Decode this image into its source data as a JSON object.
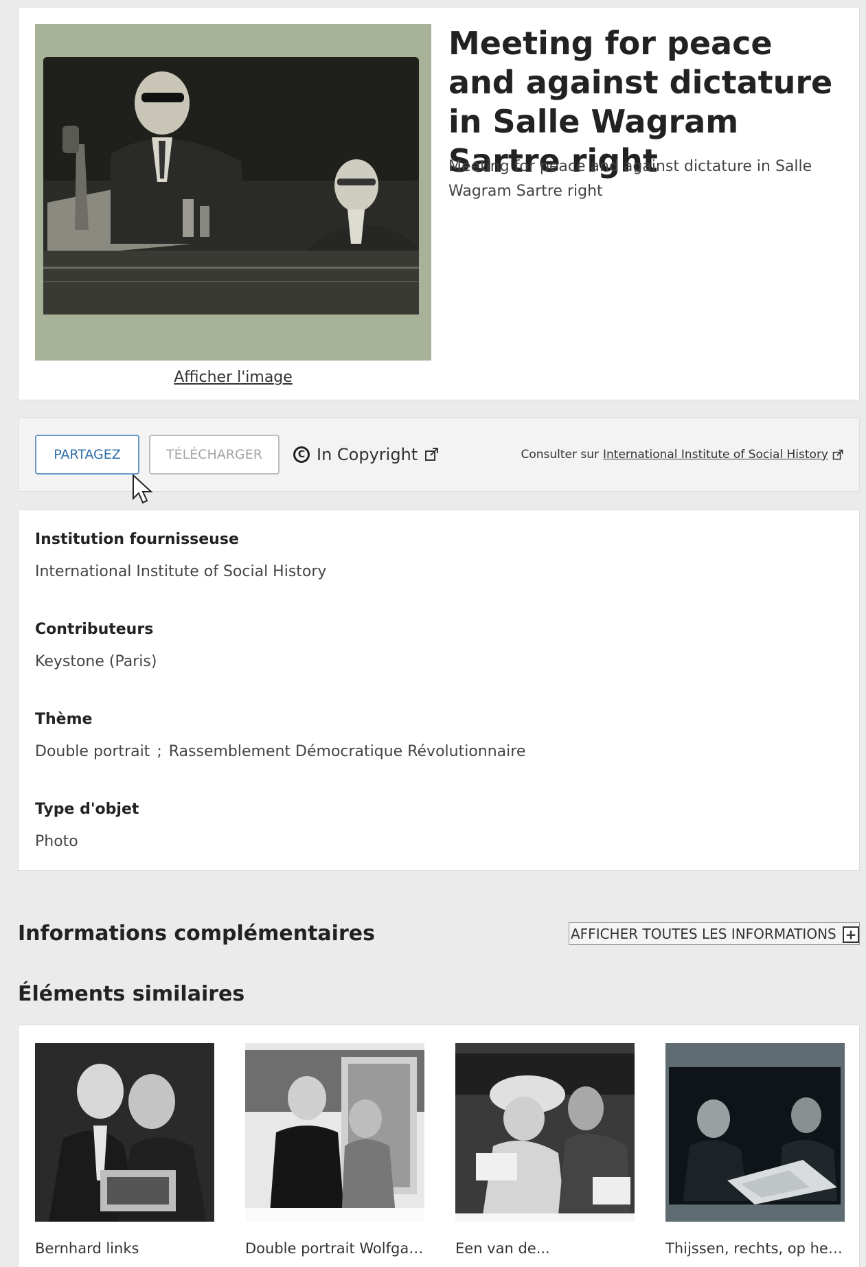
{
  "record": {
    "title": "Meeting for peace and against dictature in Salle Wagram Sartre right",
    "description": "Meeting for peace and against dictature in Salle Wagram Sartre right",
    "view_image_label": "Afficher l'image"
  },
  "actions": {
    "share_label": "PARTAGEZ",
    "download_label": "TÉLÉCHARGER",
    "rights_label": "In Copyright",
    "rights_icon": "copyright-icon",
    "consult_prefix": "Consulter sur",
    "provider_link": "International Institute of Social History"
  },
  "metadata": [
    {
      "label": "Institution fournisseuse",
      "value": "International Institute of Social History"
    },
    {
      "label": "Contributeurs",
      "value": "Keystone (Paris)"
    },
    {
      "label": "Thème",
      "values": [
        "Double portrait",
        "Rassemblement Démocratique Révolutionnaire"
      ],
      "separator": ";"
    },
    {
      "label": "Type d'objet",
      "value": "Photo"
    }
  ],
  "sections": {
    "additional_info_title": "Informations complémentaires",
    "show_all_label": "AFFICHER TOUTES LES INFORMATIONS",
    "similar_title": "Éléments similaires"
  },
  "similar_items": [
    {
      "caption": "Bernhard links"
    },
    {
      "caption": "Double portrait Wolfgan..."
    },
    {
      "caption": "Een van de..."
    },
    {
      "caption": "Thijssen, rechts, op het..."
    }
  ],
  "colors": {
    "page_bg": "#ebebeb",
    "card_bg": "#ffffff",
    "share_accent": "#2f6ea8",
    "disabled_text": "#a5a5a5"
  }
}
